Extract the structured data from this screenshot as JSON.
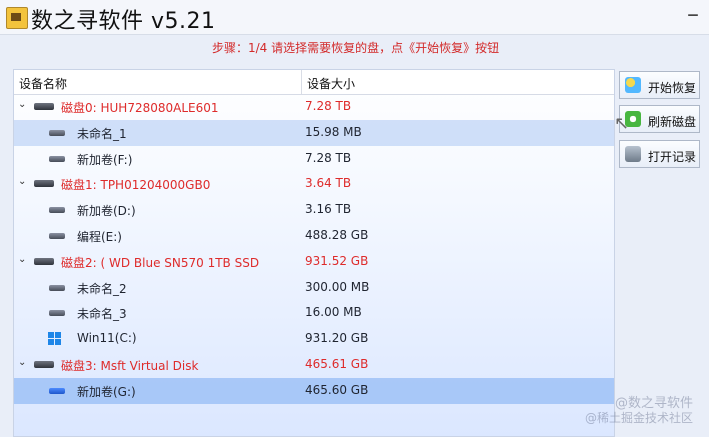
{
  "window": {
    "title": "数之寻软件 v5.21",
    "minimize_symbol": "–"
  },
  "instruction": "步骤：1/4 请选择需要恢复的盘，点《开始恢复》按钮",
  "tree": {
    "columns": [
      "设备名称",
      "设备大小"
    ],
    "rows": [
      {
        "level": 0,
        "name": "磁盘0: HUH728080ALE601",
        "size": "7.28 TB",
        "icon": "disk-icon",
        "style": "red",
        "selected": false
      },
      {
        "level": 1,
        "name": "未命名_1",
        "size": "15.98 MB",
        "icon": "volume-icon",
        "style": "dark",
        "selected": "light"
      },
      {
        "level": 1,
        "name": "新加卷(F:)",
        "size": "7.28 TB",
        "icon": "volume-icon",
        "style": "dark",
        "selected": false
      },
      {
        "level": 0,
        "name": "磁盘1: TPH01204000GB0",
        "size": "3.64 TB",
        "icon": "disk-icon",
        "style": "red",
        "selected": false
      },
      {
        "level": 1,
        "name": "新加卷(D:)",
        "size": "3.16 TB",
        "icon": "volume-icon",
        "style": "dark",
        "selected": false
      },
      {
        "level": 1,
        "name": "编程(E:)",
        "size": "488.28 GB",
        "icon": "volume-icon",
        "style": "dark",
        "selected": false
      },
      {
        "level": 0,
        "name": "磁盘2: ( WD Blue SN570 1TB SSD",
        "size": "931.52 GB",
        "icon": "disk-icon",
        "style": "red",
        "selected": false
      },
      {
        "level": 1,
        "name": "未命名_2",
        "size": "300.00 MB",
        "icon": "volume-icon",
        "style": "dark",
        "selected": false
      },
      {
        "level": 1,
        "name": "未命名_3",
        "size": "16.00 MB",
        "icon": "volume-icon",
        "style": "dark",
        "selected": false
      },
      {
        "level": 1,
        "name": "Win11(C:)",
        "size": "931.20 GB",
        "icon": "windows-icon",
        "style": "dark",
        "selected": false
      },
      {
        "level": 0,
        "name": "磁盘3: Msft     Virtual Disk",
        "size": "465.61 GB",
        "icon": "disk-icon",
        "style": "red",
        "selected": false
      },
      {
        "level": 1,
        "name": "新加卷(G:)",
        "size": "465.60 GB",
        "icon": "volume-icon",
        "style": "dark",
        "selected": "strong"
      }
    ]
  },
  "actions": {
    "start_recovery": "开始恢复",
    "refresh_disk": "刷新磁盘",
    "open_record": "打开记录"
  },
  "watermark": {
    "line1": "@数之寻软件",
    "line2": "@稀土掘金技术社区"
  }
}
